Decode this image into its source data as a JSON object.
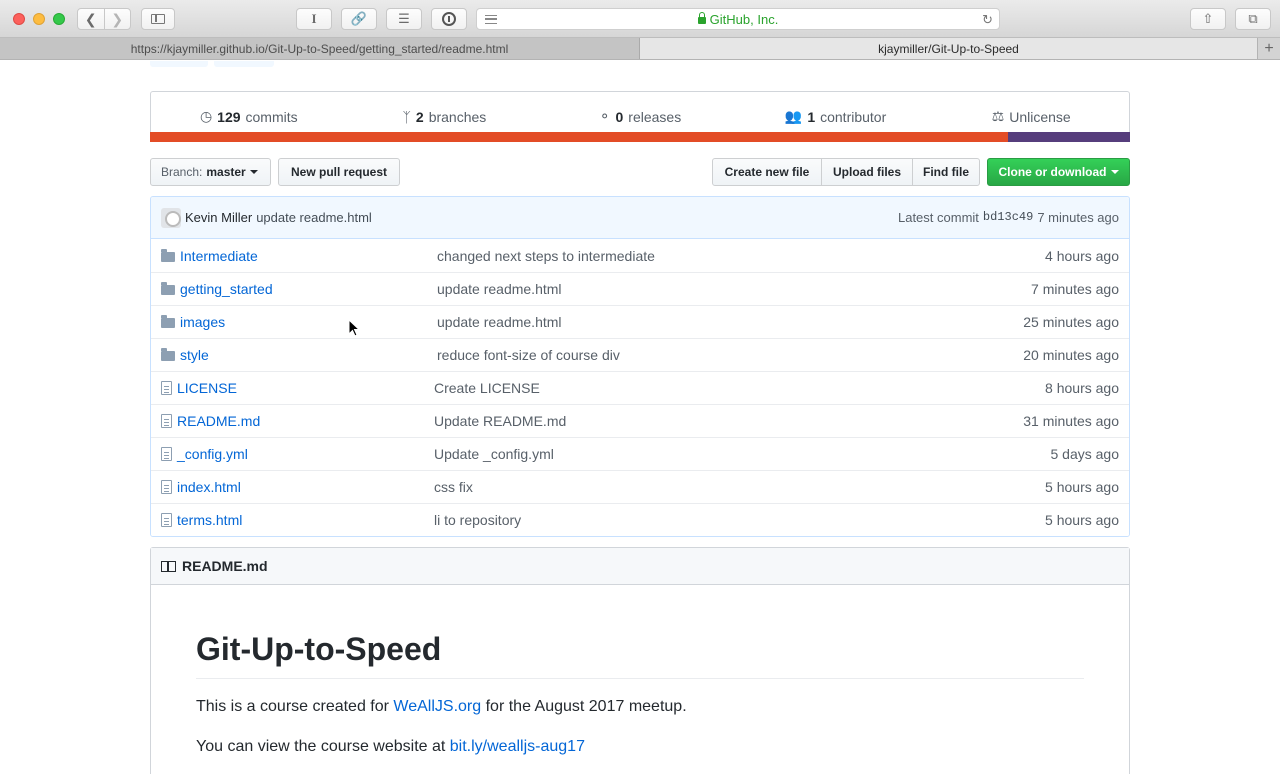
{
  "browser": {
    "url_display": "GitHub, Inc.",
    "tabs": [
      {
        "label": "https://kjaymiller.github.io/Git-Up-to-Speed/getting_started/readme.html"
      },
      {
        "label": "kjaymiller/Git-Up-to-Speed"
      }
    ]
  },
  "summary": {
    "commits": {
      "count": "129",
      "label": "commits"
    },
    "branches": {
      "count": "2",
      "label": "branches"
    },
    "releases": {
      "count": "0",
      "label": "releases"
    },
    "contributors": {
      "count": "1",
      "label": "contributor"
    },
    "license": "Unlicense"
  },
  "languages": {
    "colors": [
      "#e34c26",
      "#563d7c"
    ],
    "fractions": [
      0.875,
      0.125
    ]
  },
  "filebar": {
    "branch_label": "Branch:",
    "branch_name": "master",
    "new_pr": "New pull request",
    "create_file": "Create new file",
    "upload_files": "Upload files",
    "find_file": "Find file",
    "clone": "Clone or download"
  },
  "latest_commit": {
    "author": "Kevin Miller",
    "message": "update readme.html",
    "prefix": "Latest commit",
    "sha": "bd13c49",
    "age": "7 minutes ago"
  },
  "files": [
    {
      "type": "dir",
      "name": "Intermediate",
      "message": "changed next steps to intermediate",
      "age": "4 hours ago"
    },
    {
      "type": "dir",
      "name": "getting_started",
      "message": "update readme.html",
      "age": "7 minutes ago"
    },
    {
      "type": "dir",
      "name": "images",
      "message": "update readme.html",
      "age": "25 minutes ago"
    },
    {
      "type": "dir",
      "name": "style",
      "message": "reduce font-size of course div",
      "age": "20 minutes ago"
    },
    {
      "type": "file",
      "name": "LICENSE",
      "message": "Create LICENSE",
      "age": "8 hours ago"
    },
    {
      "type": "file",
      "name": "README.md",
      "message": "Update README.md",
      "age": "31 minutes ago"
    },
    {
      "type": "file",
      "name": "_config.yml",
      "message": "Update _config.yml",
      "age": "5 days ago"
    },
    {
      "type": "file",
      "name": "index.html",
      "message": "css fix",
      "age": "5 hours ago"
    },
    {
      "type": "file",
      "name": "terms.html",
      "message": "li to repository",
      "age": "5 hours ago"
    }
  ],
  "readme": {
    "header": "README.md",
    "title": "Git-Up-to-Speed",
    "p1_before": "This is a course created for ",
    "p1_link": "WeAllJS.org",
    "p1_after": " for the August 2017 meetup.",
    "p2_before": "You can view the course website at ",
    "p2_link": "bit.ly/wealljs-aug17"
  }
}
